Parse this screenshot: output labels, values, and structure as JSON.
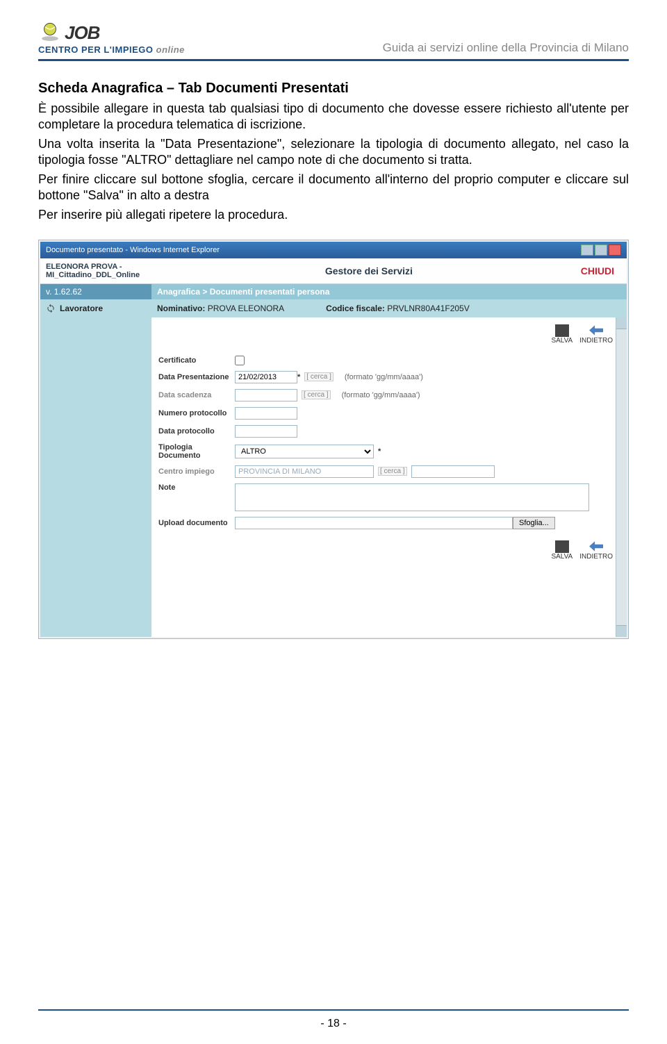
{
  "header": {
    "brand_big": "JOB",
    "brand_sub_1": "CENTRO PER L'IMPIEGO",
    "brand_sub_2": "online",
    "right_text": "Guida ai servizi online della Provincia di Milano"
  },
  "title": "Scheda Anagrafica – Tab Documenti Presentati",
  "paragraphs": {
    "p1": "È possibile allegare in questa tab qualsiasi tipo di documento che dovesse essere richiesto all'utente per completare la procedura telematica di iscrizione.",
    "p2": "Una volta inserita la \"Data Presentazione\", selezionare la tipologia di documento allegato, nel caso la tipologia fosse \"ALTRO\" dettagliare nel campo note di che documento si tratta.",
    "p3": "Per finire cliccare sul bottone sfoglia, cercare il documento all'interno del proprio computer e cliccare sul bottone \"Salva\" in alto a destra",
    "p4": "Per inserire più allegati ripetere la procedura."
  },
  "screenshot": {
    "window_title": "Documento presentato - Windows Internet Explorer",
    "user_line1": "ELEONORA PROVA -",
    "user_line2": "MI_Cittadino_DDL_Online",
    "center_title": "Gestore dei Servizi",
    "chiudi": "CHIUDI",
    "version": "v. 1.62.62",
    "breadcrumb": "Anagrafica > Documenti presentati persona",
    "lavoratore": "Lavoratore",
    "nominativo_label": "Nominativo:",
    "nominativo_value": "PROVA  ELEONORA",
    "cf_label": "Codice fiscale:",
    "cf_value": "PRVLNR80A41F205V",
    "salva": "SALVA",
    "indietro": "INDIETRO",
    "form": {
      "certificato": "Certificato",
      "data_pres_label": "Data Presentazione",
      "data_pres_value": "21/02/2013",
      "required_mark": "*",
      "cerca": "[ cerca ]",
      "hint_date": "(formato 'gg/mm/aaaa')",
      "data_scad_label": "Data scadenza",
      "num_prot_label": "Numero protocollo",
      "data_prot_label": "Data protocollo",
      "tipologia_label": "Tipologia Documento",
      "tipologia_value": "ALTRO",
      "centro_label": "Centro impiego",
      "centro_value": "PROVINCIA DI MILANO",
      "note_label": "Note",
      "upload_label": "Upload documento",
      "sfoglia": "Sfoglia..."
    }
  },
  "page_number": "- 18 -"
}
